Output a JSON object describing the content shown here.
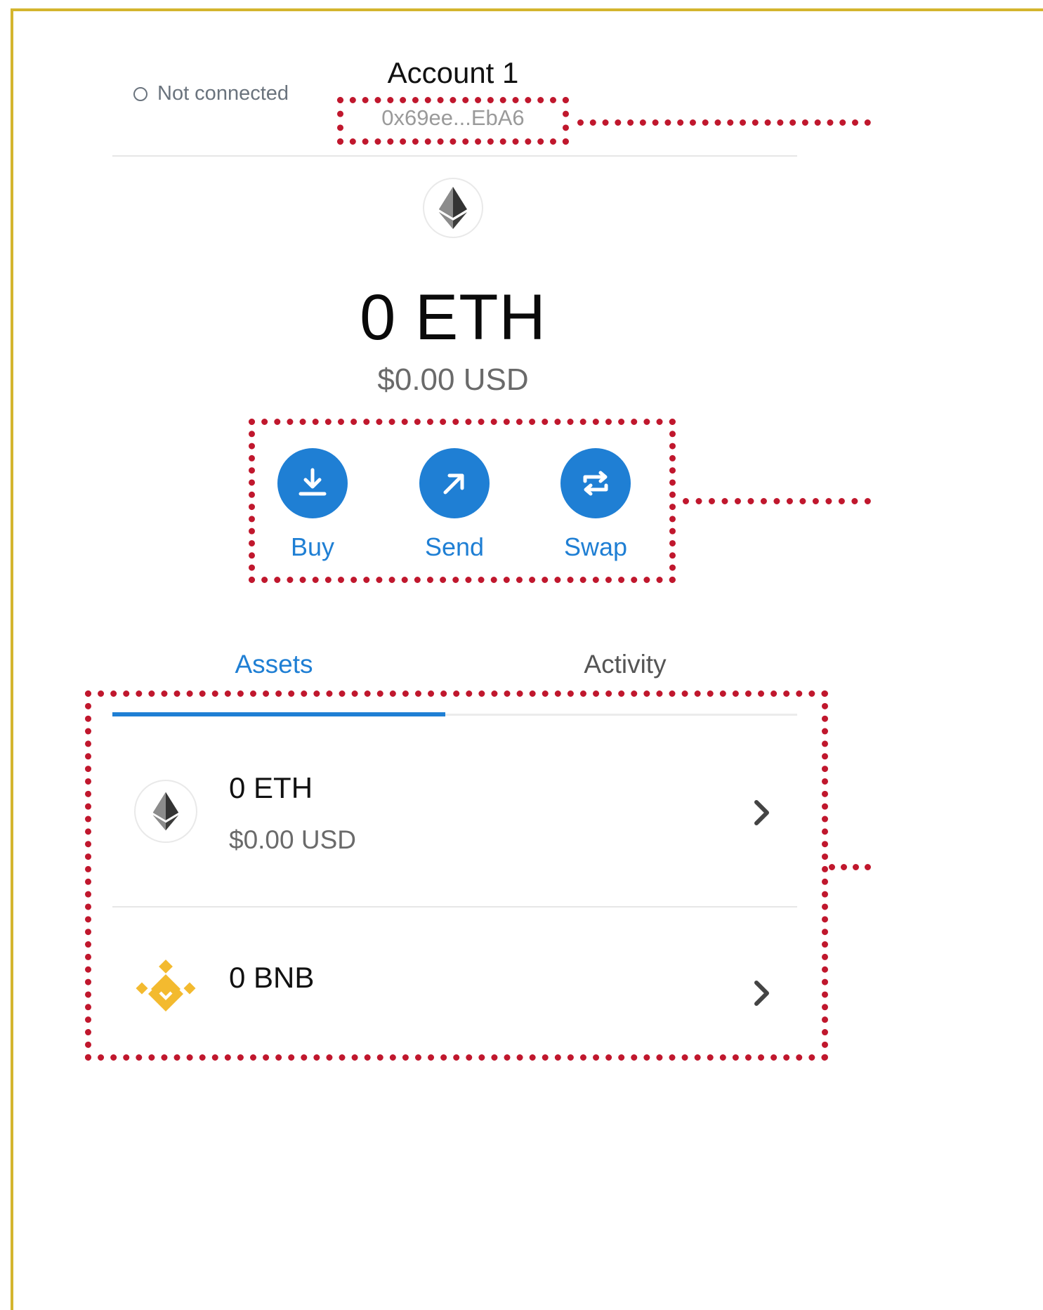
{
  "header": {
    "connection_status": "Not connected",
    "account_name": "Account 1",
    "address": "0x69ee...EbA6"
  },
  "balance": {
    "primary": "0 ETH",
    "secondary": "$0.00 USD"
  },
  "actions": [
    {
      "label": "Buy",
      "icon": "download-icon"
    },
    {
      "label": "Send",
      "icon": "arrow-up-right-icon"
    },
    {
      "label": "Swap",
      "icon": "swap-arrows-icon"
    }
  ],
  "tabs": [
    {
      "label": "Assets",
      "active": true
    },
    {
      "label": "Activity",
      "active": false
    }
  ],
  "assets": [
    {
      "amount": "0 ETH",
      "fiat": "$0.00 USD",
      "icon": "ethereum-icon"
    },
    {
      "amount": "0 BNB",
      "fiat": "",
      "icon": "bnb-icon"
    }
  ],
  "colors": {
    "accent": "#1f7fd4",
    "callout": "#c0172d",
    "frame": "#d4b52e",
    "bnb": "#f3ba2f"
  }
}
